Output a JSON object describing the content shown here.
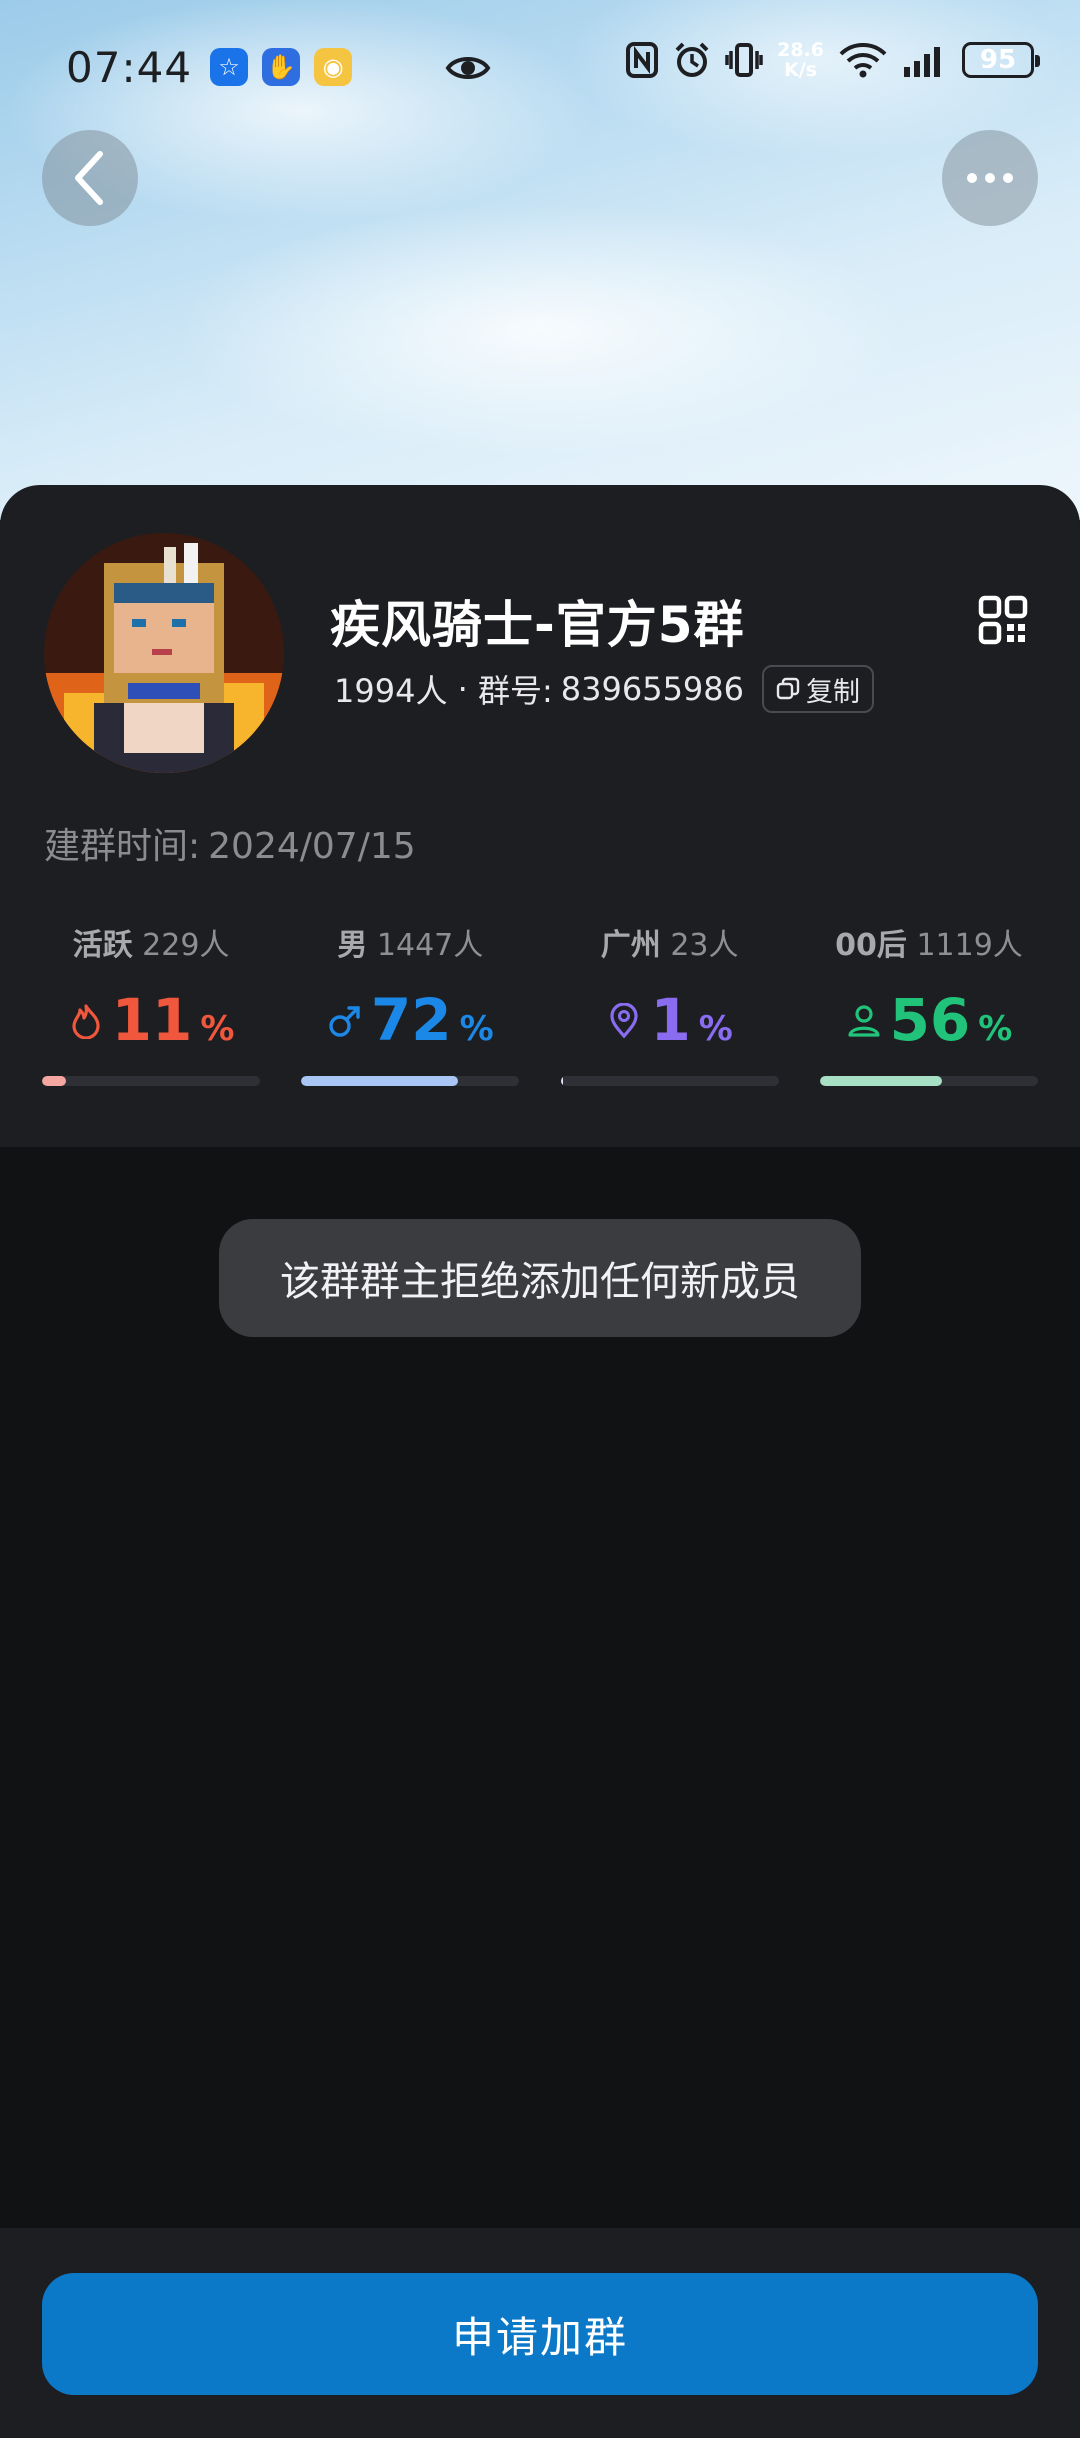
{
  "status_bar": {
    "time": "07:44",
    "app_icons": [
      {
        "name": "bulb-app-icon",
        "color": "#1a73e8",
        "glyph": "☆"
      },
      {
        "name": "hand-app-icon",
        "color": "#2f6ee0",
        "glyph": "✋"
      },
      {
        "name": "weibo-icon",
        "color": "#f5c542",
        "glyph": "◉"
      }
    ],
    "net_speed_value": "28.6",
    "net_speed_unit": "K/s",
    "battery": "95"
  },
  "group": {
    "name": "疾风骑士-官方5群",
    "member_count": "1994人",
    "id_label": "群号:",
    "id_value": "839655986",
    "copy_label": "复制",
    "created_label": "建群时间:",
    "created_value": "2024/07/15"
  },
  "stats": [
    {
      "label": "活跃",
      "count": "229人",
      "value": "11",
      "unit": "%",
      "color": "#f0573c",
      "fill_percent": 11,
      "bar_color": "#f4a7a0",
      "icon": "flame-icon"
    },
    {
      "label": "男",
      "count": "1447人",
      "value": "72",
      "unit": "%",
      "color": "#1b87e6",
      "fill_percent": 72,
      "bar_color": "#a9c6f5",
      "icon": "male-icon"
    },
    {
      "label": "广州",
      "count": "23人",
      "value": "1",
      "unit": "%",
      "color": "#8a6cf1",
      "fill_percent": 1,
      "bar_color": "#e6e3fb",
      "icon": "location-pin-icon"
    },
    {
      "label": "00后",
      "count": "1119人",
      "value": "56",
      "unit": "%",
      "color": "#21c37a",
      "fill_percent": 56,
      "bar_color": "#a7e0c4",
      "icon": "person-icon"
    }
  ],
  "toast": "该群群主拒绝添加任何新成员",
  "apply_button": "申请加群"
}
